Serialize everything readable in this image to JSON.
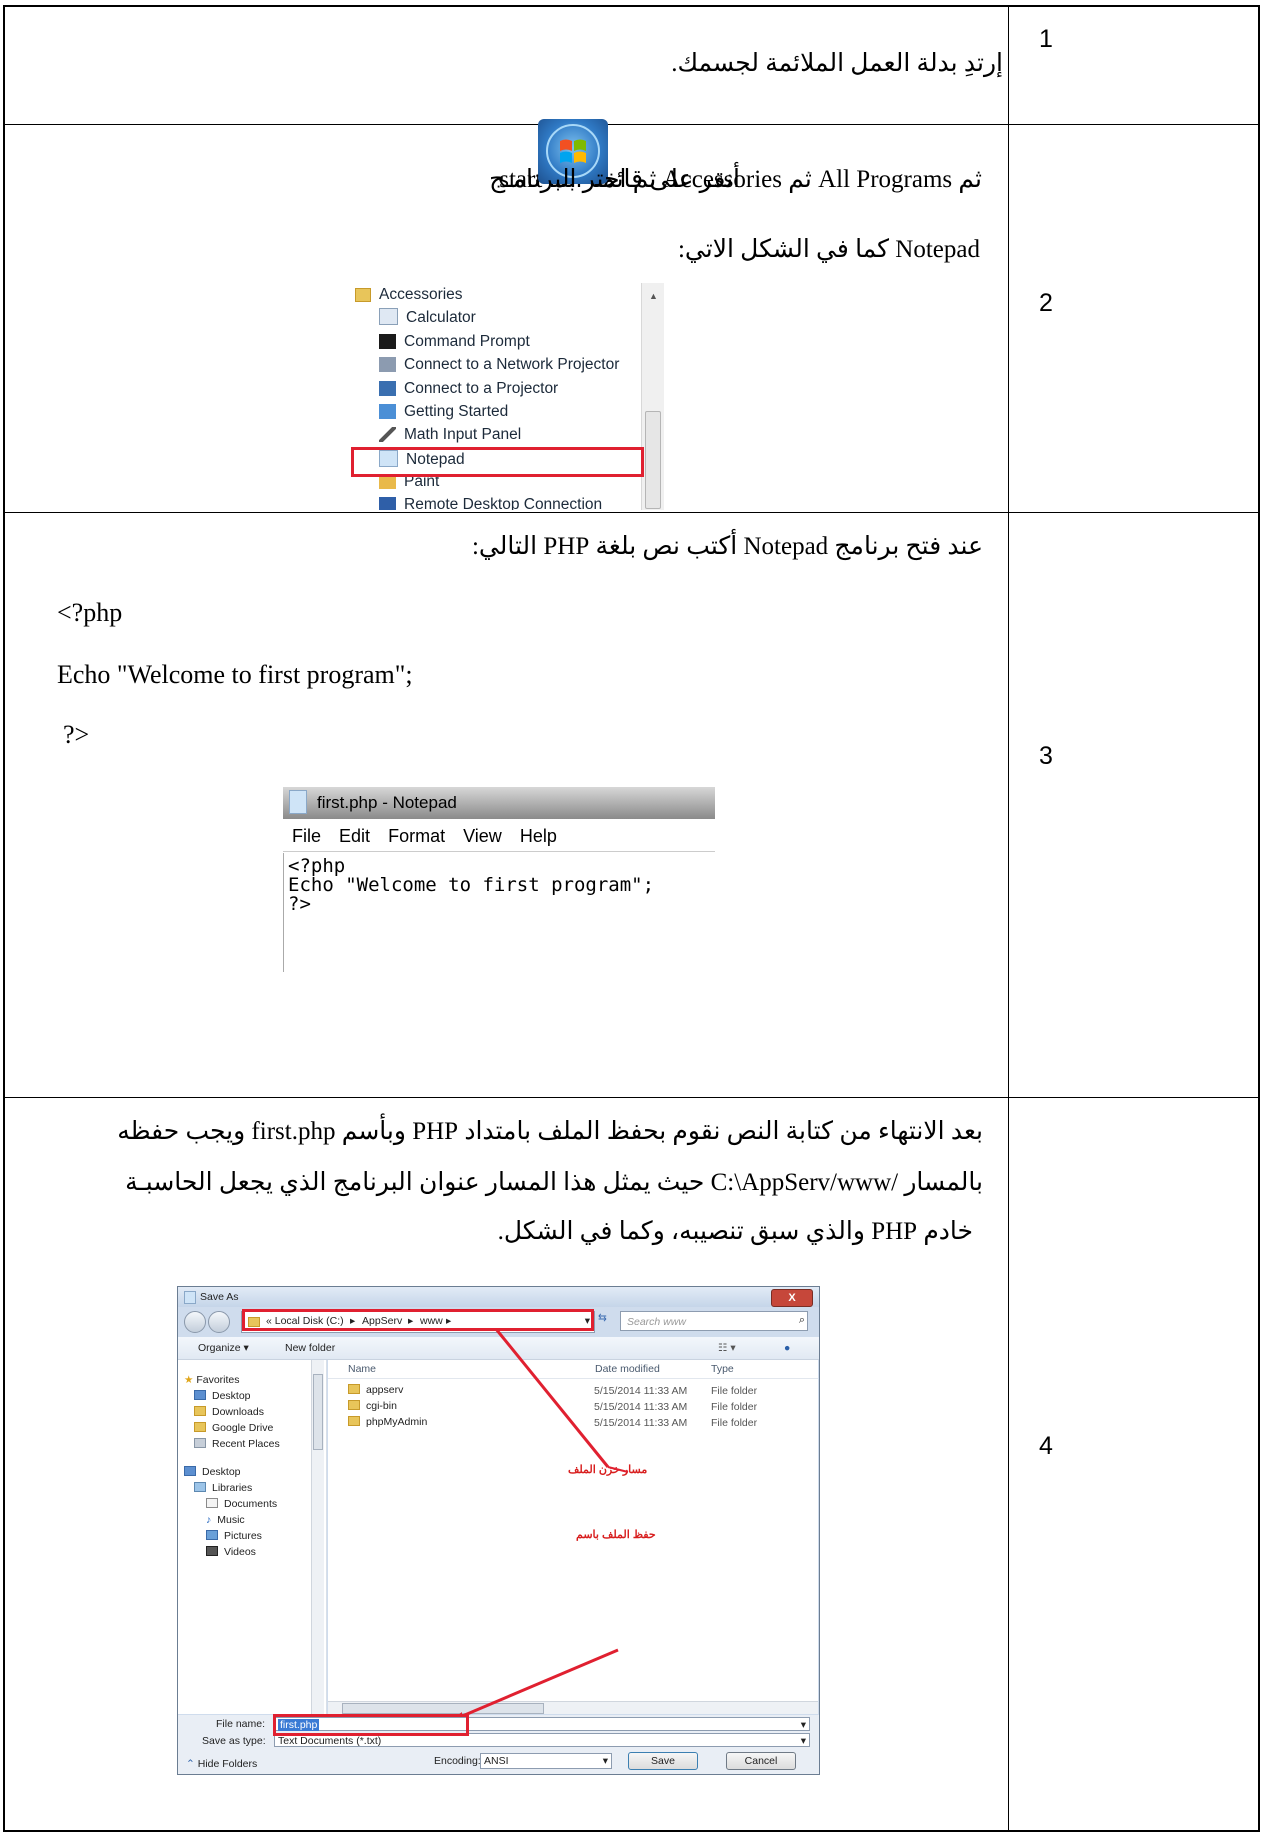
{
  "rows": [
    {
      "number": "1",
      "text": "إرتدِ بدلة العمل الملائمة لجسمك."
    },
    {
      "number": "2",
      "text_line1": "أنقر على قائمة ابدا start",
      "text_line1b": "ثم All Programs ثم Accessories ثم اختر البرنامـج",
      "text_line2": "Notepad كما في الشكل الاتي:"
    },
    {
      "number": "3",
      "intro": "عند فتح برنامج  Notepad أكتب نص بلغة PHP التالي:",
      "code": [
        "<?php",
        "Echo \"Welcome to first program\";",
        " ?>"
      ]
    },
    {
      "number": "4",
      "line1": "بعد الانتهاء من كتابة النص نقوم بحفظ الملف بامتداد  PHP وبأسم first.php ويجب حفظه",
      "line2": "بالمسار /C:\\AppServ/www حيث يمثل هذا المسار عنوان البرنامج الذي يجعل الحاسبـة",
      "line3": "خادم PHP والذي سبق تنصيبه، وكما في الشكل."
    }
  ],
  "accessories_menu": {
    "items": [
      "Accessories",
      "Calculator",
      "Command Prompt",
      "Connect to a Network Projector",
      "Connect to a Projector",
      "Getting Started",
      "Math Input Panel",
      "Notepad",
      "Paint",
      "Remote Desktop Connection"
    ],
    "highlighted": "Notepad"
  },
  "notepad": {
    "title": "first.php - Notepad",
    "menu": [
      "File",
      "Edit",
      "Format",
      "View",
      "Help"
    ],
    "content": "<?php\nEcho \"Welcome to first program\";\n?>"
  },
  "save_dialog": {
    "title": "Save As",
    "path": [
      "« Local Disk (C:)",
      "AppServ",
      "www"
    ],
    "search_placeholder": "Search www",
    "organize": "Organize ▾",
    "new_folder": "New folder",
    "nav": [
      "Favorites",
      "Desktop",
      "Downloads",
      "Google Drive",
      "Recent Places",
      "Desktop",
      "Libraries",
      "Documents",
      "Music",
      "Pictures",
      "Videos"
    ],
    "columns": [
      "Name",
      "Date modified",
      "Type"
    ],
    "files": [
      {
        "name": "appserv",
        "date": "5/15/2014 11:33 AM",
        "type": "File folder"
      },
      {
        "name": "cgi-bin",
        "date": "5/15/2014 11:33 AM",
        "type": "File folder"
      },
      {
        "name": "phpMyAdmin",
        "date": "5/15/2014 11:33 AM",
        "type": "File folder"
      }
    ],
    "annotation_path": "مسار خزن الملف",
    "annotation_name": "حفظ الملف باسم",
    "file_name_label": "File name:",
    "file_name": "first.php",
    "save_type_label": "Save as type:",
    "save_type": "Text Documents (*.txt)",
    "hide_folders": "Hide Folders",
    "encoding_label": "Encoding:",
    "encoding": "ANSI",
    "save_btn": "Save",
    "cancel_btn": "Cancel",
    "close": "X"
  }
}
